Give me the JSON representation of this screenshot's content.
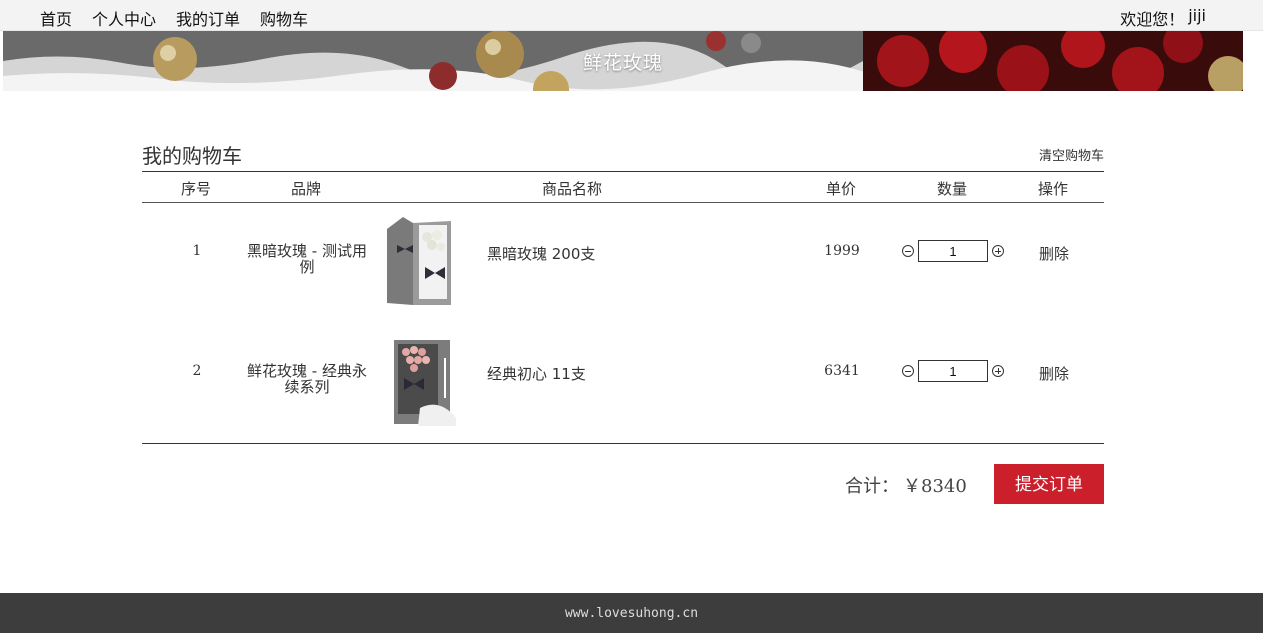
{
  "nav": {
    "links": [
      "首页",
      "个人中心",
      "我的订单",
      "购物车"
    ],
    "welcome_prefix": "欢迎您！",
    "username": "jiji"
  },
  "banner": {
    "title": "鲜花玫瑰"
  },
  "cart": {
    "title": "我的购物车",
    "clear_label": "清空购物车",
    "columns": [
      "序号",
      "品牌",
      "商品名称",
      "单价",
      "数量",
      "操作"
    ],
    "rows": [
      {
        "index": "1",
        "brand": "黑暗玫瑰 - 测试用例",
        "product": "黑暗玫瑰 200支",
        "price": "1999",
        "quantity": "1",
        "action": "删除"
      },
      {
        "index": "2",
        "brand": "鲜花玫瑰 - 经典永续系列",
        "product": "经典初心 11支",
        "price": "6341",
        "quantity": "1",
        "action": "删除"
      }
    ],
    "total_label": "合计：",
    "total_value": "￥8340",
    "submit_label": "提交订单"
  },
  "footer": {
    "text": "www.lovesuhong.cn"
  },
  "colors": {
    "accent": "#cc1f2c",
    "footer_bg": "#3d3d3d",
    "nav_bg": "#f3f3f3"
  }
}
